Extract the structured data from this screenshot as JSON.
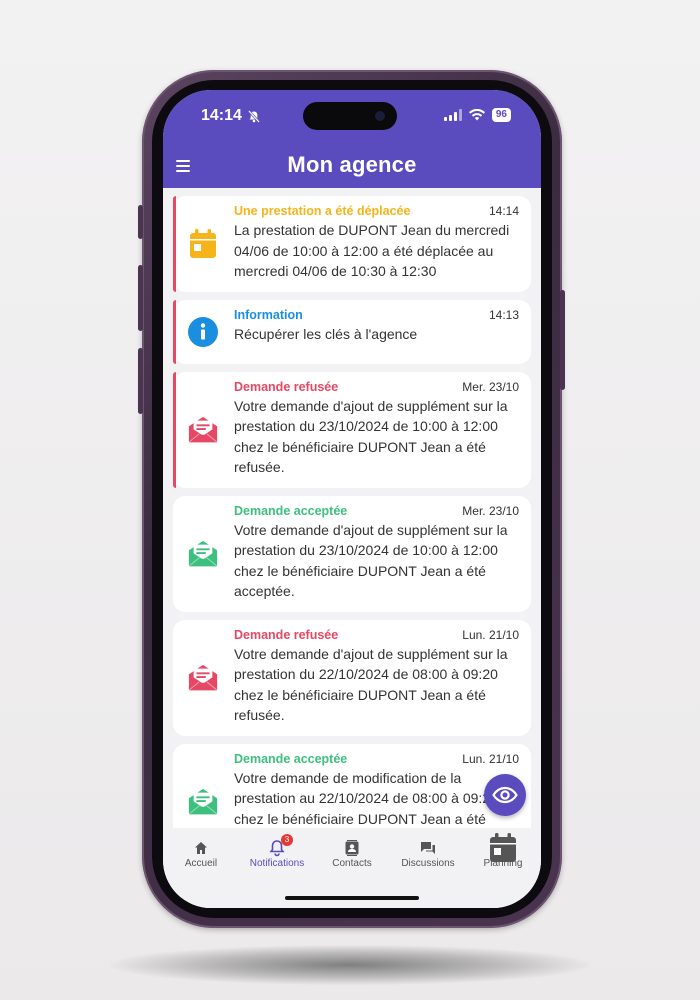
{
  "status": {
    "time": "14:14",
    "battery": "96"
  },
  "header": {
    "title": "Mon agence"
  },
  "notifications": [
    {
      "title": "Une prestation a été déplacée",
      "date": "14:14",
      "body": "La prestation de DUPONT Jean du mercredi 04/06 de 10:00 à 12:00 a été déplacée au mercredi 04/06 de 10:30 à 12:30",
      "color": "#f5b41a",
      "icon": "calendar-icon",
      "unread": true
    },
    {
      "title": "Information",
      "date": "14:13",
      "body": "Récupérer les clés à l'agence",
      "color": "#1a8fe0",
      "icon": "info-icon",
      "unread": true
    },
    {
      "title": "Demande refusée",
      "date": "Mer. 23/10",
      "body": "Votre demande d'ajout de supplément sur la prestation du 23/10/2024 de 10:00 à 12:00 chez le bénéficiaire DUPONT Jean a été refusée.",
      "color": "#e54864",
      "icon": "envelope-open-icon",
      "unread": true
    },
    {
      "title": "Demande acceptée",
      "date": "Mer. 23/10",
      "body": "Votre demande d'ajout de supplément sur la prestation du 23/10/2024 de 10:00 à 12:00 chez le bénéficiaire DUPONT Jean a été acceptée.",
      "color": "#3dbf7e",
      "icon": "envelope-open-icon",
      "unread": false
    },
    {
      "title": "Demande refusée",
      "date": "Lun. 21/10",
      "body": "Votre demande d'ajout de supplément sur la prestation du 22/10/2024 de 08:00 à 09:20 chez le bénéficiaire DUPONT Jean a été refusée.",
      "color": "#e54864",
      "icon": "envelope-open-icon",
      "unread": false
    },
    {
      "title": "Demande acceptée",
      "date": "Lun. 21/10",
      "body": "Votre demande de modification de la prestation au 22/10/2024 de 08:00 à 09:20 chez le bénéficiaire DUPONT Jean a été acceptée.",
      "color": "#3dbf7e",
      "icon": "envelope-open-icon",
      "unread": false
    }
  ],
  "tabs": [
    {
      "label": "Accueil",
      "icon": "home-icon"
    },
    {
      "label": "Notifications",
      "icon": "bell-icon",
      "badge": "3",
      "active": true
    },
    {
      "label": "Contacts",
      "icon": "contacts-icon"
    },
    {
      "label": "Discussions",
      "icon": "chat-icon"
    },
    {
      "label": "Planning",
      "icon": "calendar-icon"
    }
  ],
  "colors": {
    "primary": "#5a4bbf",
    "unread_accent": "#e54864"
  }
}
